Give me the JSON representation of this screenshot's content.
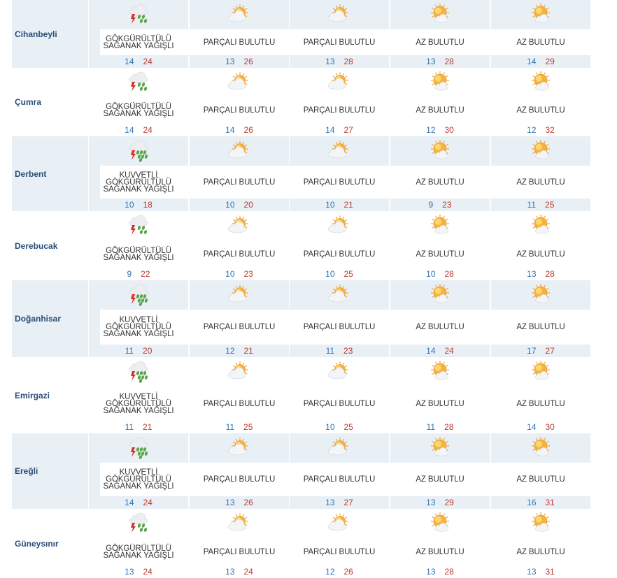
{
  "forecast": {
    "rows": [
      {
        "city": "Cihanbeyli",
        "days": [
          {
            "icon": "thunder-rain-icon",
            "desc": "GÖKGÜRÜLTÜLÜ SAĞANAK YAĞIŞLI",
            "min": "14",
            "max": "24"
          },
          {
            "icon": "partly-cloudy-icon",
            "desc": "PARÇALI BULUTLU",
            "min": "13",
            "max": "26"
          },
          {
            "icon": "partly-cloudy-icon",
            "desc": "PARÇALI BULUTLU",
            "min": "13",
            "max": "28"
          },
          {
            "icon": "mostly-sunny-icon",
            "desc": "AZ BULUTLU",
            "min": "13",
            "max": "28"
          },
          {
            "icon": "mostly-sunny-icon",
            "desc": "AZ BULUTLU",
            "min": "14",
            "max": "29"
          }
        ]
      },
      {
        "city": "Çumra",
        "days": [
          {
            "icon": "thunder-rain-icon",
            "desc": "GÖKGÜRÜLTÜLÜ SAĞANAK YAĞIŞLI",
            "min": "14",
            "max": "24"
          },
          {
            "icon": "partly-cloudy-icon",
            "desc": "PARÇALI BULUTLU",
            "min": "14",
            "max": "26"
          },
          {
            "icon": "partly-cloudy-icon",
            "desc": "PARÇALI BULUTLU",
            "min": "14",
            "max": "27"
          },
          {
            "icon": "mostly-sunny-icon",
            "desc": "AZ BULUTLU",
            "min": "12",
            "max": "30"
          },
          {
            "icon": "mostly-sunny-icon",
            "desc": "AZ BULUTLU",
            "min": "12",
            "max": "32"
          }
        ]
      },
      {
        "city": "Derbent",
        "days": [
          {
            "icon": "heavy-thunder-rain-icon",
            "desc": "KUVVETLİ GÖKGÜRÜLTÜLÜ SAĞANAK YAĞIŞLI",
            "min": "10",
            "max": "18"
          },
          {
            "icon": "partly-cloudy-icon",
            "desc": "PARÇALI BULUTLU",
            "min": "10",
            "max": "20"
          },
          {
            "icon": "partly-cloudy-icon",
            "desc": "PARÇALI BULUTLU",
            "min": "10",
            "max": "21"
          },
          {
            "icon": "mostly-sunny-icon",
            "desc": "AZ BULUTLU",
            "min": "9",
            "max": "23"
          },
          {
            "icon": "mostly-sunny-icon",
            "desc": "AZ BULUTLU",
            "min": "11",
            "max": "25"
          }
        ]
      },
      {
        "city": "Derebucak",
        "days": [
          {
            "icon": "thunder-rain-icon",
            "desc": "GÖKGÜRÜLTÜLÜ SAĞANAK YAĞIŞLI",
            "min": "9",
            "max": "22"
          },
          {
            "icon": "partly-cloudy-icon",
            "desc": "PARÇALI BULUTLU",
            "min": "10",
            "max": "23"
          },
          {
            "icon": "partly-cloudy-icon",
            "desc": "PARÇALI BULUTLU",
            "min": "10",
            "max": "25"
          },
          {
            "icon": "mostly-sunny-icon",
            "desc": "AZ BULUTLU",
            "min": "10",
            "max": "28"
          },
          {
            "icon": "mostly-sunny-icon",
            "desc": "AZ BULUTLU",
            "min": "13",
            "max": "28"
          }
        ]
      },
      {
        "city": "Doğanhisar",
        "days": [
          {
            "icon": "heavy-thunder-rain-icon",
            "desc": "KUVVETLİ GÖKGÜRÜLTÜLÜ SAĞANAK YAĞIŞLI",
            "min": "11",
            "max": "20"
          },
          {
            "icon": "partly-cloudy-icon",
            "desc": "PARÇALI BULUTLU",
            "min": "12",
            "max": "21"
          },
          {
            "icon": "partly-cloudy-icon",
            "desc": "PARÇALI BULUTLU",
            "min": "11",
            "max": "23"
          },
          {
            "icon": "mostly-sunny-icon",
            "desc": "AZ BULUTLU",
            "min": "14",
            "max": "24"
          },
          {
            "icon": "mostly-sunny-icon",
            "desc": "AZ BULUTLU",
            "min": "17",
            "max": "27"
          }
        ]
      },
      {
        "city": "Emirgazi",
        "days": [
          {
            "icon": "heavy-thunder-rain-icon",
            "desc": "KUVVETLİ GÖKGÜRÜLTÜLÜ SAĞANAK YAĞIŞLI",
            "min": "11",
            "max": "21"
          },
          {
            "icon": "partly-cloudy-icon",
            "desc": "PARÇALI BULUTLU",
            "min": "11",
            "max": "25"
          },
          {
            "icon": "partly-cloudy-icon",
            "desc": "PARÇALI BULUTLU",
            "min": "10",
            "max": "25"
          },
          {
            "icon": "mostly-sunny-icon",
            "desc": "AZ BULUTLU",
            "min": "11",
            "max": "28"
          },
          {
            "icon": "mostly-sunny-icon",
            "desc": "AZ BULUTLU",
            "min": "14",
            "max": "30"
          }
        ]
      },
      {
        "city": "Ereğli",
        "days": [
          {
            "icon": "heavy-thunder-rain-icon",
            "desc": "KUVVETLİ GÖKGÜRÜLTÜLÜ SAĞANAK YAĞIŞLI",
            "min": "14",
            "max": "24"
          },
          {
            "icon": "partly-cloudy-icon",
            "desc": "PARÇALI BULUTLU",
            "min": "13",
            "max": "26"
          },
          {
            "icon": "partly-cloudy-icon",
            "desc": "PARÇALI BULUTLU",
            "min": "13",
            "max": "27"
          },
          {
            "icon": "mostly-sunny-icon",
            "desc": "AZ BULUTLU",
            "min": "13",
            "max": "29"
          },
          {
            "icon": "mostly-sunny-icon",
            "desc": "AZ BULUTLU",
            "min": "16",
            "max": "31"
          }
        ]
      },
      {
        "city": "Güneysınır",
        "days": [
          {
            "icon": "thunder-rain-icon",
            "desc": "GÖKGÜRÜLTÜLÜ SAĞANAK YAĞIŞLI",
            "min": "13",
            "max": "24"
          },
          {
            "icon": "partly-cloudy-icon",
            "desc": "PARÇALI BULUTLU",
            "min": "13",
            "max": "24"
          },
          {
            "icon": "partly-cloudy-icon",
            "desc": "PARÇALI BULUTLU",
            "min": "12",
            "max": "26"
          },
          {
            "icon": "mostly-sunny-icon",
            "desc": "AZ BULUTLU",
            "min": "13",
            "max": "28"
          },
          {
            "icon": "mostly-sunny-icon",
            "desc": "AZ BULUTLU",
            "min": "13",
            "max": "31"
          }
        ]
      }
    ]
  },
  "colors": {
    "stripe": "#e8eff5",
    "city": "#2a4e78",
    "min_temp": "#2e74b5",
    "max_temp": "#c0392b"
  }
}
